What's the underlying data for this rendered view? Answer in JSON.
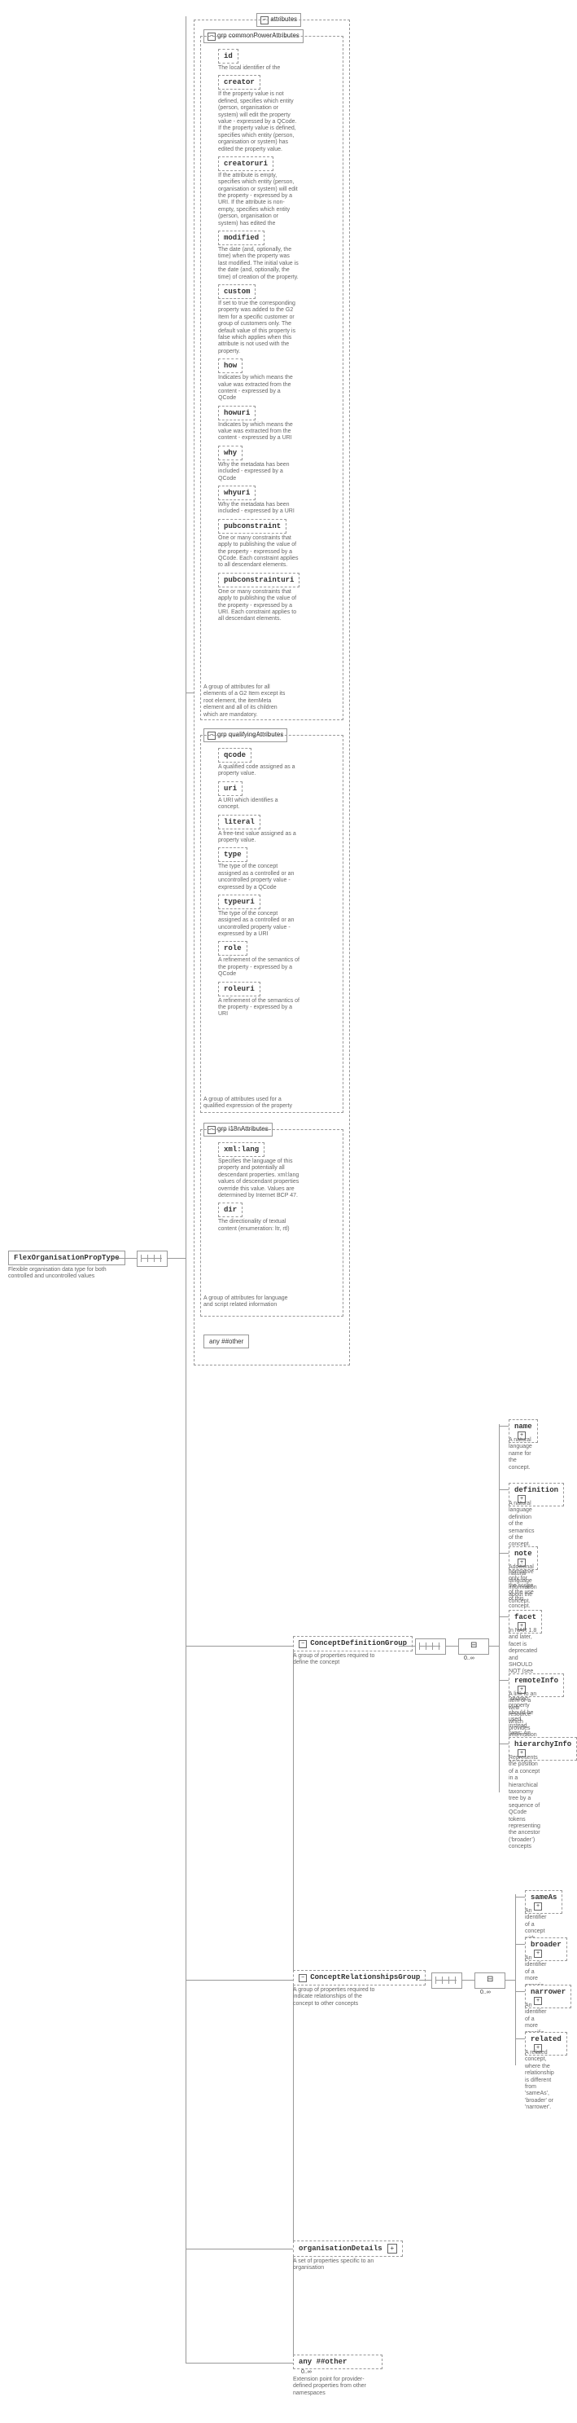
{
  "root": {
    "label": "FlexOrganisationPropType",
    "desc": "Flexible organisation data type for both controlled and uncontrolled values"
  },
  "attributes_label": "attributes",
  "groups": {
    "commonPower": {
      "title": "grp commonPowerAttributes",
      "items": [
        {
          "name": "id",
          "desc": "The local identifier of the"
        },
        {
          "name": "creator",
          "desc": "If the property value is not defined, specifies which entity (person, organisation or system) will edit the property value - expressed by a QCode. If the property value is defined, specifies which entity (person, organisation or system) has edited the property value."
        },
        {
          "name": "creatoruri",
          "desc": "If the attribute is empty, specifies which entity (person, organisation or system) will edit the property - expressed by a URI. If the attribute is non-empty, specifies which entity (person, organisation or system) has edited the"
        },
        {
          "name": "modified",
          "desc": "The date (and, optionally, the time) when the property was last modified. The initial value is the date (and, optionally, the time) of creation of the property."
        },
        {
          "name": "custom",
          "desc": "If set to true the corresponding property was added to the G2 Item for a specific customer or group of customers only. The default value of this property is false which applies when this attribute is not used with the property."
        },
        {
          "name": "how",
          "desc": "Indicates by which means the value was extracted from the content - expressed by a QCode"
        },
        {
          "name": "howuri",
          "desc": "Indicates by which means the value was extracted from the content - expressed by a URI"
        },
        {
          "name": "why",
          "desc": "Why the metadata has been included - expressed by a QCode"
        },
        {
          "name": "whyuri",
          "desc": "Why the metadata has been included - expressed by a URI"
        },
        {
          "name": "pubconstraint",
          "desc": "One or many constraints that apply to publishing the value of the property - expressed by a QCode. Each constraint applies to all descendant elements."
        },
        {
          "name": "pubconstrainturi",
          "desc": "One or many constraints that apply to publishing the value of the property - expressed by a URI. Each constraint applies to all descendant elements."
        }
      ],
      "footer": "A group of attributes for all elements of a G2 Item except its root element, the itemMeta element and all of its children which are mandatory."
    },
    "qualifying": {
      "title": "grp qualifyingAttributes",
      "items": [
        {
          "name": "qcode",
          "desc": "A qualified code assigned as a property value."
        },
        {
          "name": "uri",
          "desc": "A URI which identifies a concept."
        },
        {
          "name": "literal",
          "desc": "A free-text value assigned as a property value."
        },
        {
          "name": "type",
          "desc": "The type of the concept assigned as a controlled or an uncontrolled property value - expressed by a QCode"
        },
        {
          "name": "typeuri",
          "desc": "The type of the concept assigned as a controlled or an uncontrolled property value - expressed by a URI"
        },
        {
          "name": "role",
          "desc": "A refinement of the semantics of the property - expressed by a QCode"
        },
        {
          "name": "roleuri",
          "desc": "A refinement of the semantics of the property - expressed by a URI"
        }
      ],
      "footer": "A group of attributes used for a qualified expression of the property"
    },
    "i18n": {
      "title": "grp i18nAttributes",
      "items": [
        {
          "name": "xml:lang",
          "desc": "Specifies the language of this property and potentially all descendant properties. xml:lang values of descendant properties override this value. Values are determined by Internet BCP 47."
        },
        {
          "name": "dir",
          "desc": "The directionality of textual content (enumeration: ltr, rtl)"
        }
      ],
      "footer": "A group of attributes for language and script related information"
    }
  },
  "any_other": "any ##other",
  "conceptDef": {
    "title": "ConceptDefinitionGroup",
    "desc": "A group of properties required to define the concept",
    "items": [
      {
        "name": "name",
        "desc": "A natural language name for the concept."
      },
      {
        "name": "definition",
        "desc": "A natural language definition of the semantics of the concept. This definition is normative only for the scope of the use of this concept."
      },
      {
        "name": "note",
        "desc": "Additional natural language information about the concept."
      },
      {
        "name": "facet",
        "desc": "In NAR 1.8 and later, facet is deprecated and SHOULD NOT (see RFC 2119) be used, the \"related\" property should be used instead. (was: An intrinsic property of the concept.)"
      },
      {
        "name": "remoteInfo",
        "desc": "A link to an item or a web resource which provides information about the"
      },
      {
        "name": "hierarchyInfo",
        "desc": "Represents the position of a concept in a hierarchical taxonomy tree by a sequence of QCode tokens representing the ancestor (‘broader’) concepts"
      }
    ]
  },
  "conceptRel": {
    "title": "ConceptRelationshipsGroup",
    "desc": "A group of properties required to indicate relationships of the concept to other concepts",
    "items": [
      {
        "name": "sameAs",
        "desc": "An identifier of a concept with equivalent semantics"
      },
      {
        "name": "broader",
        "desc": "An identifier of a more generic concept."
      },
      {
        "name": "narrower",
        "desc": "An identifier of a more specific concept."
      },
      {
        "name": "related",
        "desc": "A related concept, where the relationship is different from 'sameAs', 'broader' or 'narrower'."
      }
    ]
  },
  "orgDetails": {
    "name": "organisationDetails",
    "desc": "A set of properties specific to an organisation"
  },
  "extAny": {
    "name": "any ##other",
    "desc": "Extension point for provider-defined properties from other namespaces",
    "card": "0..∞"
  },
  "card_0inf": "0..∞"
}
